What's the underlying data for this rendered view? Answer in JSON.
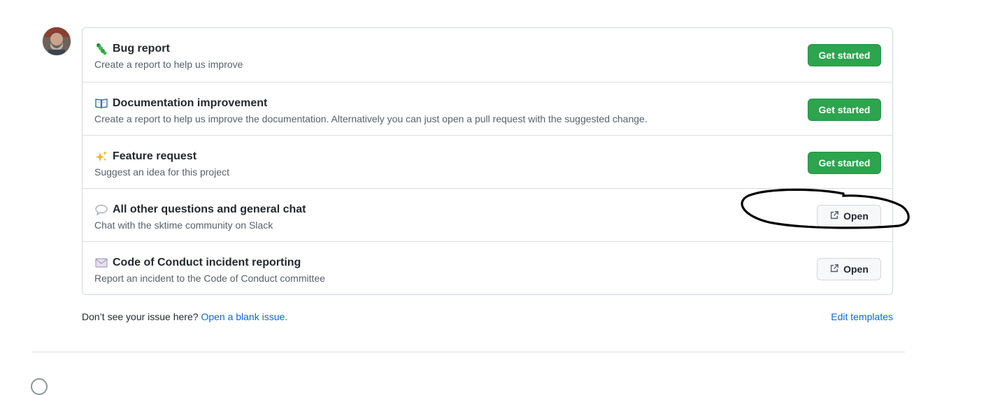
{
  "templates": [
    {
      "icon": "caterpillar-icon",
      "title": "Bug report",
      "description": "Create a report to help us improve",
      "button": "Get started",
      "button_type": "primary"
    },
    {
      "icon": "open-book-icon",
      "title": "Documentation improvement",
      "description": "Create a report to help us improve the documentation. Alternatively you can just open a pull request with the suggested change.",
      "button": "Get started",
      "button_type": "primary"
    },
    {
      "icon": "sparkles-icon",
      "title": "Feature request",
      "description": "Suggest an idea for this project",
      "button": "Get started",
      "button_type": "primary"
    },
    {
      "icon": "speech-bubble-icon",
      "title": "All other questions and general chat",
      "description": "Chat with the sktime community on Slack",
      "button": "Open",
      "button_type": "external"
    },
    {
      "icon": "envelope-icon",
      "title": "Code of Conduct incident reporting",
      "description": "Report an incident to the Code of Conduct committee",
      "button": "Open",
      "button_type": "external"
    }
  ],
  "footer": {
    "prompt": "Don’t see your issue here?",
    "blank_issue_link": "Open a blank issue.",
    "edit_templates_link": "Edit templates"
  },
  "colors": {
    "primary_button": "#2da44e",
    "link": "#0969da",
    "annotation_stroke": "#000000"
  }
}
